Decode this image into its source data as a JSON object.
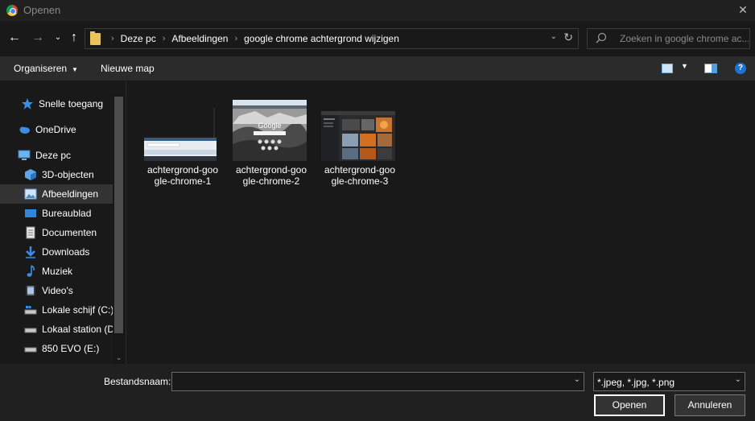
{
  "window": {
    "title": "Openen"
  },
  "address": {
    "crumbs": [
      "Deze pc",
      "Afbeeldingen",
      "google chrome achtergrond wijzigen"
    ]
  },
  "search": {
    "placeholder": "Zoeken in google chrome ac..."
  },
  "toolbar": {
    "organize_label": "Organiseren",
    "new_folder_label": "Nieuwe map"
  },
  "sidebar": {
    "items": [
      {
        "label": "Snelle toegang",
        "icon": "star-icon"
      },
      {
        "label": "OneDrive",
        "icon": "cloud-icon"
      },
      {
        "label": "Deze pc",
        "icon": "computer-icon"
      },
      {
        "label": "3D-objecten",
        "icon": "cube-icon"
      },
      {
        "label": "Afbeeldingen",
        "icon": "pictures-icon",
        "selected": true
      },
      {
        "label": "Bureaublad",
        "icon": "desktop-icon"
      },
      {
        "label": "Documenten",
        "icon": "document-icon"
      },
      {
        "label": "Downloads",
        "icon": "download-icon"
      },
      {
        "label": "Muziek",
        "icon": "music-icon"
      },
      {
        "label": "Video's",
        "icon": "video-icon"
      },
      {
        "label": "Lokale schijf (C:)",
        "icon": "drive-c-icon"
      },
      {
        "label": "Lokaal station (D",
        "icon": "drive-icon"
      },
      {
        "label": "850 EVO (E:)",
        "icon": "drive-icon"
      }
    ]
  },
  "files": [
    {
      "name_line1": "achtergrond-goo",
      "name_line2": "gle-chrome-1"
    },
    {
      "name_line1": "achtergrond-goo",
      "name_line2": "gle-chrome-2"
    },
    {
      "name_line1": "achtergrond-goo",
      "name_line2": "gle-chrome-3"
    }
  ],
  "thumb_text": {
    "google": "Google"
  },
  "bottom": {
    "filename_label": "Bestandsnaam:",
    "filename_value": "",
    "filetype_value": "*.jpeg, *.jpg, *.png",
    "open_label": "Openen",
    "cancel_label": "Annuleren"
  },
  "colors": {
    "accent": "#1e73d2",
    "selected_bg": "#333333",
    "folder": "#e9c45a"
  }
}
